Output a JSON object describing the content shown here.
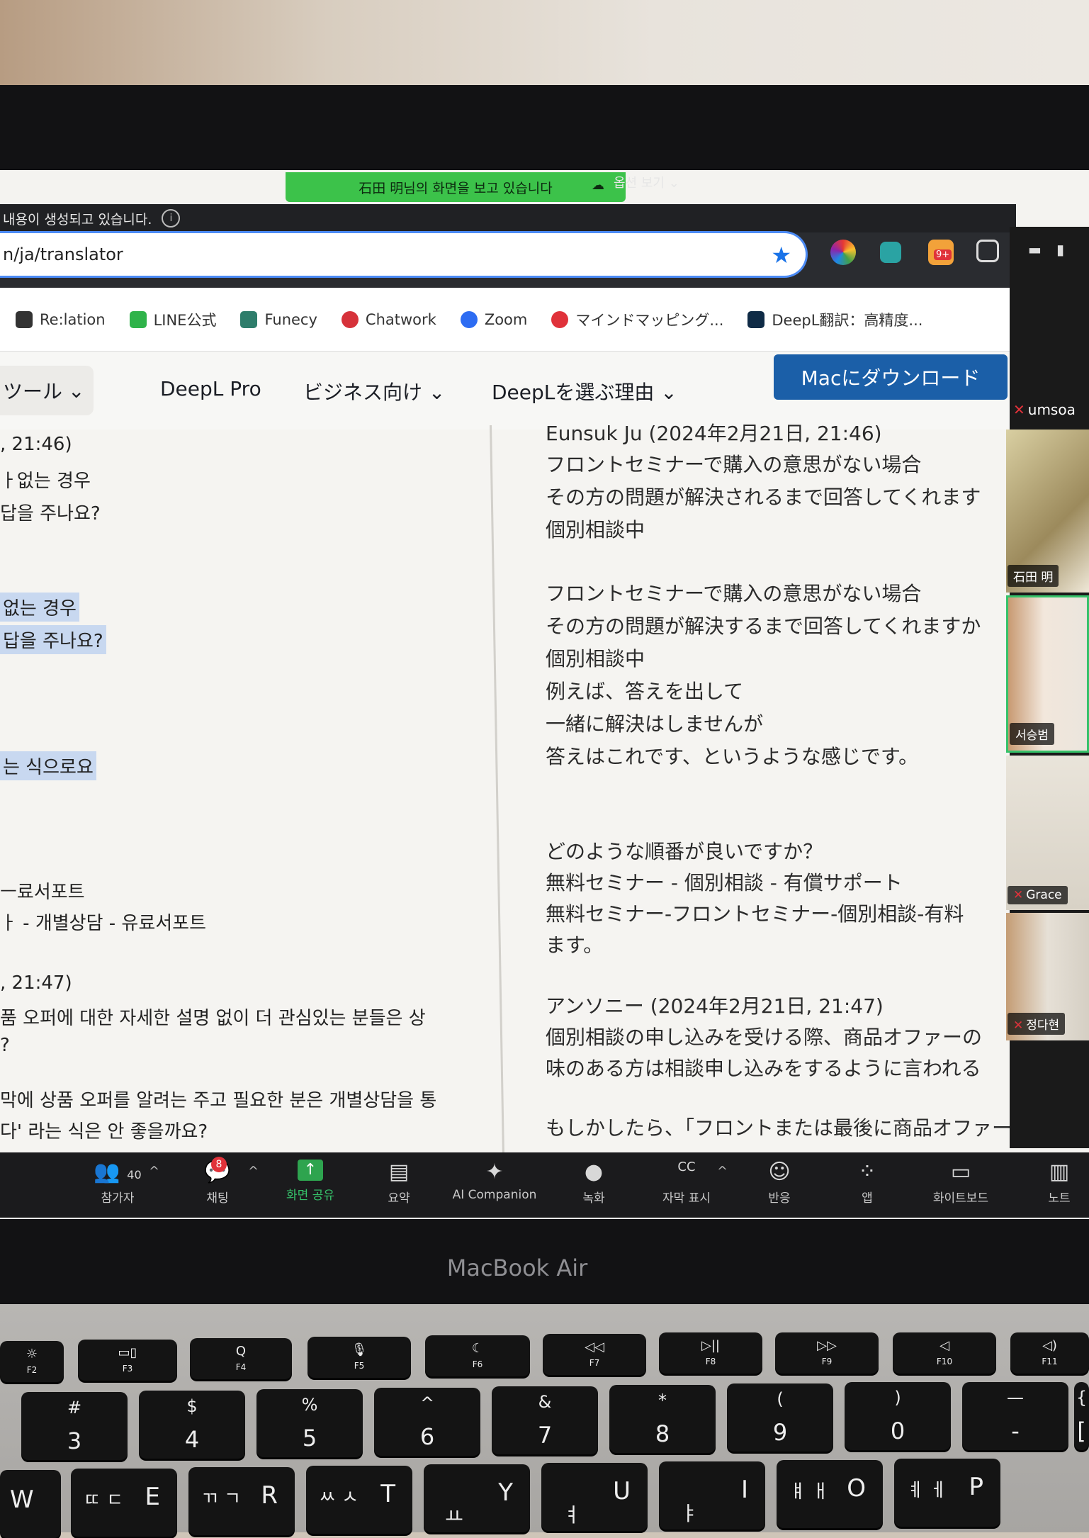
{
  "zoom": {
    "share_banner": "石田 明님의 화면을 보고 있습니다",
    "view_options": "옵션 보기",
    "notice": "내용이 생성되고 있습니다.",
    "toolbar": [
      {
        "label": "참가자",
        "count": "40",
        "icon": "participants-icon"
      },
      {
        "label": "채팅",
        "badge": "8",
        "icon": "chat-icon"
      },
      {
        "label": "화면 공유",
        "icon": "share-screen-icon"
      },
      {
        "label": "요약",
        "icon": "summary-icon"
      },
      {
        "label": "AI Companion",
        "icon": "ai-companion-icon"
      },
      {
        "label": "녹화",
        "icon": "record-icon"
      },
      {
        "label": "자막 표시",
        "icon": "captions-icon"
      },
      {
        "label": "반응",
        "icon": "reactions-icon"
      },
      {
        "label": "앱",
        "icon": "apps-icon"
      },
      {
        "label": "화이트보드",
        "icon": "whiteboard-icon"
      },
      {
        "label": "노트",
        "icon": "notes-icon"
      }
    ],
    "gallery": {
      "label_top": "umsoa",
      "tiles": [
        "石田 明",
        "서승범",
        "Grace",
        "정다현"
      ]
    }
  },
  "browser": {
    "url": "n/ja/translator",
    "bookmarks": [
      {
        "label": "Re:lation",
        "color": "#333333"
      },
      {
        "label": "LINE公式",
        "color": "#2fb34a"
      },
      {
        "label": "Funecy",
        "color": "#2e7d6b"
      },
      {
        "label": "Chatwork",
        "color": "#d6323a"
      },
      {
        "label": "Zoom",
        "color": "#2d6cf2"
      },
      {
        "label": "マインドマッピング...",
        "color": "#e0323a"
      },
      {
        "label": "DeepL翻訳：高精度...",
        "color": "#0f2b46"
      }
    ],
    "extension_badge": "9+"
  },
  "deepl": {
    "nav": {
      "tools": "ツール",
      "pro": "DeepL Pro",
      "business": "ビジネス向け",
      "why": "DeepLを選ぶ理由",
      "download": "Macにダウンロード"
    },
    "left_lines": [
      ", 21:46)",
      "ㅏ없는 경우",
      "답을 주나요?",
      "없는 경우",
      "답을 주나요?",
      "는 식으로요",
      "ㅡ료서포트",
      "ㅏ - 개별상담 - 유료서포트",
      ", 21:47)",
      "품 오퍼에 대한 자세한 설명 없이 더 관심있는 분들은 상",
      "?",
      "막에 상품 오퍼를 알려는 주고 필요한 분은 개별상담을 통",
      "다' 라는 식은 안 좋을까요?"
    ],
    "right_lines": [
      "Eunsuk Ju (2024年2月21日, 21:46)",
      "フロントセミナーで購入の意思がない場合",
      "その方の問題が解決されるまで回答してくれます",
      "個別相談中",
      "フロントセミナーで購入の意思がない場合",
      "その方の問題が解決するまで回答してくれますか",
      "個別相談中",
      "例えば、答えを出して",
      "一緒に解決はしませんが",
      "答えはこれです、というような感じです。",
      "どのような順番が良いですか？",
      "無料セミナー - 個別相談 - 有償サポート",
      "無料セミナー-フロントセミナー-個別相談-有料",
      "ます。",
      "アンソニー (2024年2月21日, 21:47)",
      "個別相談の申し込みを受ける際、商品オファーの",
      "味のある方は相談申し込みをするように言われる",
      "もしかしたら、「フロントまたは最後に商品オファーを知"
    ]
  },
  "device": {
    "brand": "MacBook Air",
    "fkeys": [
      {
        "top": "☼",
        "bot": "F2"
      },
      {
        "top": "▭▯",
        "bot": "F3"
      },
      {
        "top": "Q",
        "bot": "F4"
      },
      {
        "top": "🎙",
        "bot": "F5"
      },
      {
        "top": "☾",
        "bot": "F6"
      },
      {
        "top": "◁◁",
        "bot": "F7"
      },
      {
        "top": "▷||",
        "bot": "F8"
      },
      {
        "top": "▷▷",
        "bot": "F9"
      },
      {
        "top": "◁",
        "bot": "F10"
      },
      {
        "top": "◁)",
        "bot": "F11"
      }
    ],
    "numkeys": [
      {
        "top": "#",
        "bot": "3"
      },
      {
        "top": "$",
        "bot": "4"
      },
      {
        "top": "%",
        "bot": "5"
      },
      {
        "top": "^",
        "bot": "6"
      },
      {
        "top": "&",
        "bot": "7"
      },
      {
        "top": "*",
        "bot": "8"
      },
      {
        "top": "(",
        "bot": "9"
      },
      {
        "top": ")",
        "bot": "0"
      },
      {
        "top": "—",
        "bot": "-"
      },
      {
        "top": "{",
        "bot": "["
      }
    ],
    "letterkeys": [
      {
        "latin": "W",
        "hangul": ""
      },
      {
        "latin": "E",
        "hangul": "ㄸ ㄷ"
      },
      {
        "latin": "R",
        "hangul": "ㄲ ㄱ"
      },
      {
        "latin": "T",
        "hangul": "ㅆ ㅅ"
      },
      {
        "latin": "Y",
        "hangul": "ㅛ"
      },
      {
        "latin": "U",
        "hangul": "ㅕ"
      },
      {
        "latin": "I",
        "hangul": "ㅑ"
      },
      {
        "latin": "O",
        "hangul": "ㅒ ㅐ"
      },
      {
        "latin": "P",
        "hangul": "ㅖ ㅔ"
      }
    ]
  }
}
